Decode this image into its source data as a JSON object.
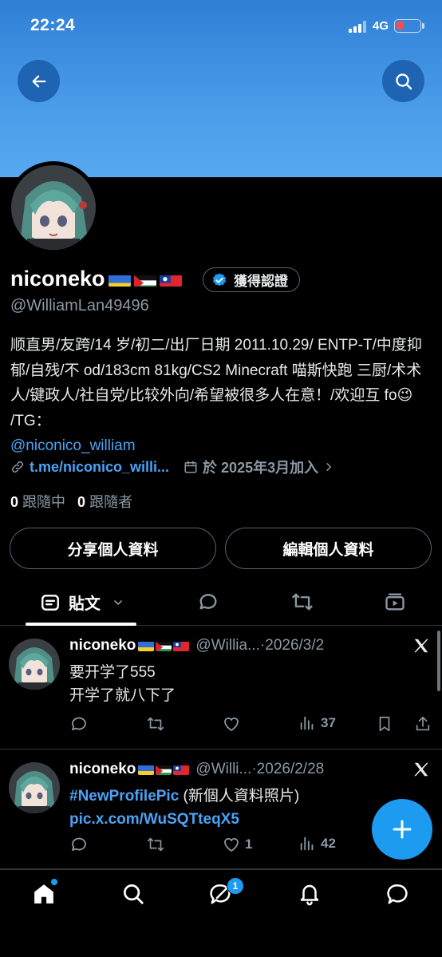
{
  "status_bar": {
    "time": "22:24",
    "network": "4G"
  },
  "profile": {
    "name": "niconeko",
    "verified_label": "獲得認證",
    "handle": "@WilliamLan49496",
    "bio_text": "顺直男/友跨/14 岁/初二/出厂日期 2011.10.29/ ENTP-T/中度抑郁/自残/不 od/183cm 81kg/CS2 Minecraft 喵斯快跑 三厨/术术人/键政人/社自党/比较外向/希望被很多人在意！/欢迎互 fo",
    "bio_emoji": "😉",
    "bio_tg_label": " /TG：",
    "bio_tg_link": "@niconico_william",
    "website": "t.me/niconico_willi...",
    "joined": "於 2025年3月加入",
    "following_count": "0",
    "following_label": "跟隨中",
    "followers_count": "0",
    "followers_label": "跟隨者"
  },
  "buttons": {
    "share": "分享個人資料",
    "edit": "編輯個人資料"
  },
  "tabs": {
    "posts": "貼文"
  },
  "tweets": [
    {
      "name": "niconeko",
      "handle": "@Willia...",
      "date": "·2026/3/2",
      "lines": [
        "要开学了555",
        "开学了就八下了"
      ],
      "views": "37"
    },
    {
      "name": "niconeko",
      "handle": "@Willi...",
      "date": "·2026/2/28",
      "hashtag": "#NewProfilePic",
      "text": " (新個人資料照片) ",
      "link": "pic.x.com/WuSQTteqX5",
      "likes": "1",
      "views": "42"
    }
  ],
  "nav": {
    "messages_badge": "1"
  },
  "colors": {
    "accent": "#1d9bf0",
    "banner": "#4a9ce9",
    "link": "#4ba3f5"
  }
}
